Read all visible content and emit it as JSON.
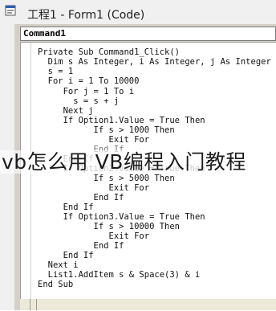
{
  "window": {
    "title": "工程1 - Form1 (Code)"
  },
  "object_combo": {
    "value": "Command1"
  },
  "code_lines": [
    "Private Sub Command1_Click()",
    "  Dim s As Integer, i As Integer, j As Integer",
    "  s = 1",
    "  For i = 1 To 10000",
    "     For j = 1 To i",
    "       s = s + j",
    "     Next j",
    "     If Option1.Value = True Then",
    "           If s > 1000 Then",
    "              Exit For",
    "           End If",
    "     End If",
    "     If Option2.Value = True Then",
    "           If s > 5000 Then",
    "              Exit For",
    "           End If",
    "     End If",
    "     If Option3.Value = True Then",
    "           If s > 10000 Then",
    "              Exit For",
    "           End If",
    "     End If",
    "  Next i",
    "  List1.AddItem s & Space(3) & i",
    "End Sub"
  ],
  "watermark": "vb怎么用   VB编程入门教程"
}
